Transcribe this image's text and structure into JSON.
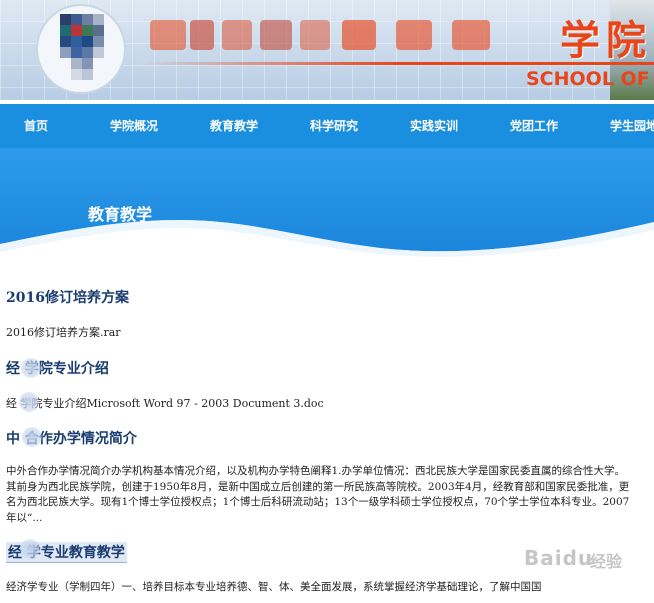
{
  "header": {
    "title_visible": "学院",
    "subtitle": "SCHOOL OF"
  },
  "nav": {
    "items": [
      {
        "label": "首页"
      },
      {
        "label": "学院概况"
      },
      {
        "label": "教育教学"
      },
      {
        "label": "科学研究"
      },
      {
        "label": "实践实训"
      },
      {
        "label": "党团工作"
      },
      {
        "label": "学生园地"
      }
    ]
  },
  "hero": {
    "title": "教育教学"
  },
  "sections": [
    {
      "heading": "2016修订培养方案",
      "link": "2016修订培养方案.rar"
    },
    {
      "heading": "经 学院专业介绍",
      "link": "经 学院专业介绍Microsoft Word 97 - 2003 Document 3.doc"
    },
    {
      "heading": "中 合作办学情况简介",
      "paragraph": "中外合作办学情况简介办学机构基本情况介绍，以及机构办学特色阐释1.办学单位情况：西北民族大学是国家民委直属的综合性大学。其前身为西北民族学院，创建于1950年8月，是新中国成立后创建的第一所民族高等院校。2003年4月，经教育部和国家民委批准，更名为西北民族大学。现有1个博士学位授权点；1个博士后科研流动站；13个一级学科硕士学位授权点，70个学士学位本科专业。2007年以“..."
    },
    {
      "heading": "经 学专业教育教学",
      "paragraph": "经济学专业（学制四年）一、培养目标本专业培养德、智、体、美全面发展，系统掌握经济学基础理论，了解中国国"
    }
  ],
  "watermark": {
    "brand": "Baidu",
    "suffix": "经验"
  },
  "colors": {
    "nav_bg": "#1a8fe0",
    "heading": "#1a3d70",
    "banner_accent": "#e8451b"
  }
}
